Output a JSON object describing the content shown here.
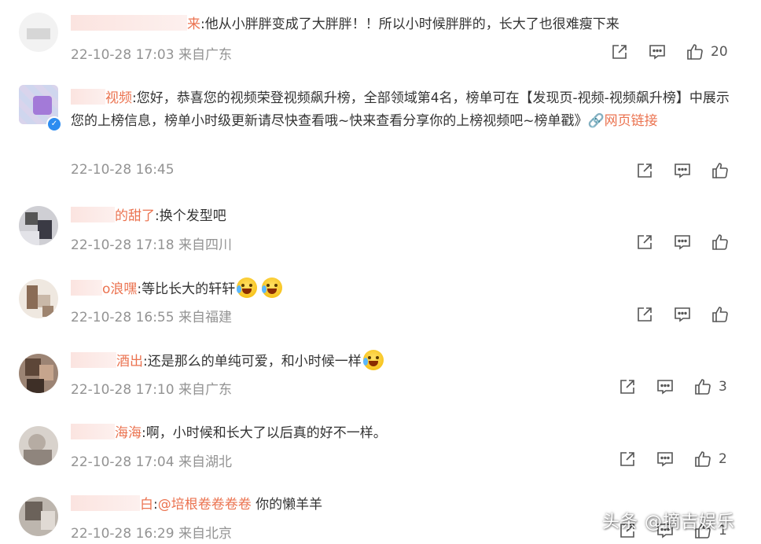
{
  "colors": {
    "name": "#eb7350",
    "meta": "#939393",
    "text": "#333333",
    "verified": "#2d8cf0"
  },
  "comments": [
    {
      "name": "来",
      "colon": ":",
      "content": "他从小胖胖变成了大胖胖！！所以小时候胖胖的，长大了也很难瘦下来",
      "time": "22-10-28 17:03",
      "location": "来自广东",
      "likes": "20"
    },
    {
      "name": "视频",
      "colon": ":",
      "content": "您好，恭喜您的视频荣登视频飙升榜，全部领域第4名，榜单可在【发现页-视频-视频飙升榜】中展示您的上榜信息，榜单小时级更新请尽快查看哦~快来查看分享你的上榜视频吧~榜单戳》",
      "link_icon": "🔗",
      "link_text": "网页链接",
      "time": "22-10-28 16:45",
      "location": "",
      "likes": ""
    },
    {
      "name": "的甜了",
      "colon": ":",
      "content": "换个发型吧",
      "time": "22-10-28 17:18",
      "location": "来自四川",
      "likes": ""
    },
    {
      "name": "o浪嘿",
      "colon": ":",
      "content": "等比长大的轩轩",
      "time": "22-10-28 16:55",
      "location": "来自福建",
      "likes": ""
    },
    {
      "name": "酒出",
      "colon": ":",
      "content": "还是那么的单纯可爱，和小时候一样",
      "time": "22-10-28 17:10",
      "location": "来自广东",
      "likes": "3"
    },
    {
      "name": "海海",
      "colon": ":",
      "content": "啊，小时候和长大了以后真的好不一样。",
      "time": "22-10-28 17:04",
      "location": "来自湖北",
      "likes": "2"
    },
    {
      "name": "白",
      "colon": ":",
      "mention": "@培根卷卷卷卷",
      "content": " 你的懒羊羊",
      "time": "22-10-28 16:29",
      "location": "来自北京",
      "likes": "1"
    }
  ],
  "icons": {
    "share": "share-icon",
    "comment": "comment-icon",
    "like": "like-icon",
    "verified": "verified-badge-icon",
    "emoji": "laugh-cry-emoji-icon",
    "link": "link-icon"
  },
  "watermark": "头条 @摘吉娱乐"
}
